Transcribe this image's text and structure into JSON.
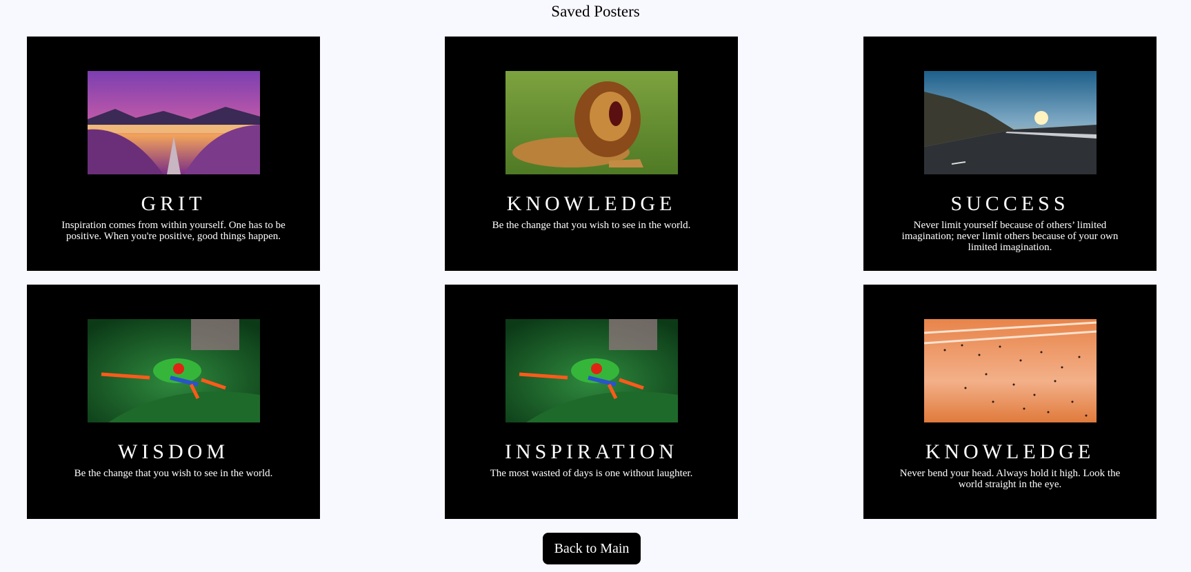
{
  "header": {
    "title": "Saved Posters"
  },
  "posters": [
    {
      "title": "GRIT",
      "quote": "Inspiration comes from within yourself. One has to be positive. When you're positive, good things happen.",
      "image": "purple-lake-sunset"
    },
    {
      "title": "KNOWLEDGE",
      "quote": "Be the change that you wish to see in the world.",
      "image": "roaring-lion"
    },
    {
      "title": "SUCCESS",
      "quote": "Never limit yourself because of others’ limited imagination; never limit others because of your own limited imagination.",
      "image": "mountain-road-sunrise"
    },
    {
      "title": "WISDOM",
      "quote": "Be the change that you wish to see in the world.",
      "image": "tree-frog"
    },
    {
      "title": "INSPIRATION",
      "quote": "The most wasted of days is one without laughter.",
      "image": "tree-frog"
    },
    {
      "title": "KNOWLEDGE",
      "quote": "Never bend your head. Always hold it high. Look the world straight in the eye.",
      "image": "bird-flock-sunset"
    }
  ],
  "actions": {
    "back_label": "Back to Main"
  }
}
